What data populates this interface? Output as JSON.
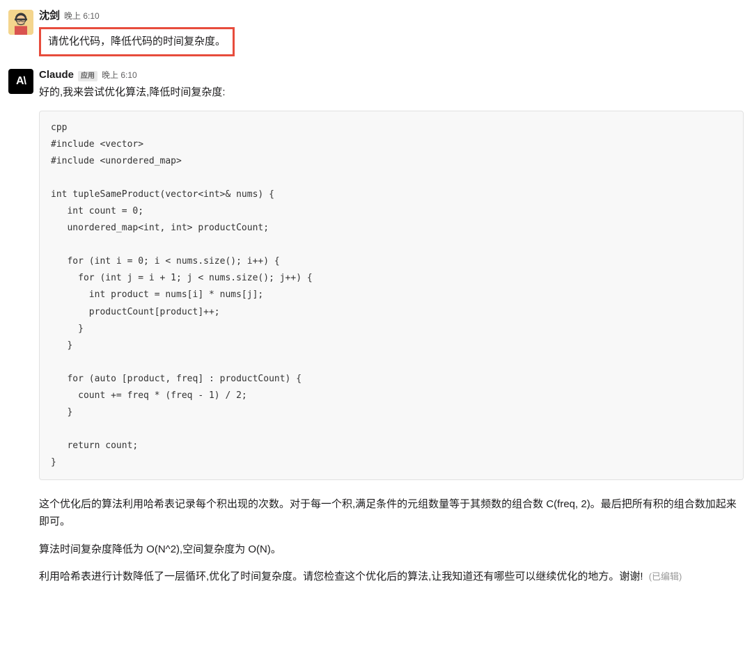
{
  "messages": [
    {
      "author": "沈剑",
      "timestamp": "晚上 6:10",
      "highlighted_text": "请优化代码，降低代码的时间复杂度。"
    },
    {
      "author": "Claude",
      "app_badge": "应用",
      "timestamp": "晚上 6:10",
      "intro": "好的,我来尝试优化算法,降低时间复杂度:",
      "code": "cpp\n#include <vector>\n#include <unordered_map>\n\nint tupleSameProduct(vector<int>& nums) {\n   int count = 0;\n   unordered_map<int, int> productCount;\n\n   for (int i = 0; i < nums.size(); i++) {\n     for (int j = i + 1; j < nums.size(); j++) {\n       int product = nums[i] * nums[j];\n       productCount[product]++;\n     }\n   }\n\n   for (auto [product, freq] : productCount) {\n     count += freq * (freq - 1) / 2;\n   }\n\n   return count;\n}",
      "para1": "这个优化后的算法利用哈希表记录每个积出现的次数。对于每一个积,满足条件的元组数量等于其频数的组合数 C(freq, 2)。最后把所有积的组合数加起来即可。",
      "para2": "算法时间复杂度降低为 O(N^2),空间复杂度为 O(N)。",
      "para3": "利用哈希表进行计数降低了一层循环,优化了时间复杂度。请您检查这个优化后的算法,让我知道还有哪些可以继续优化的地方。谢谢!",
      "edited": "(已编辑)"
    }
  ],
  "claude_avatar_text": "A\\"
}
